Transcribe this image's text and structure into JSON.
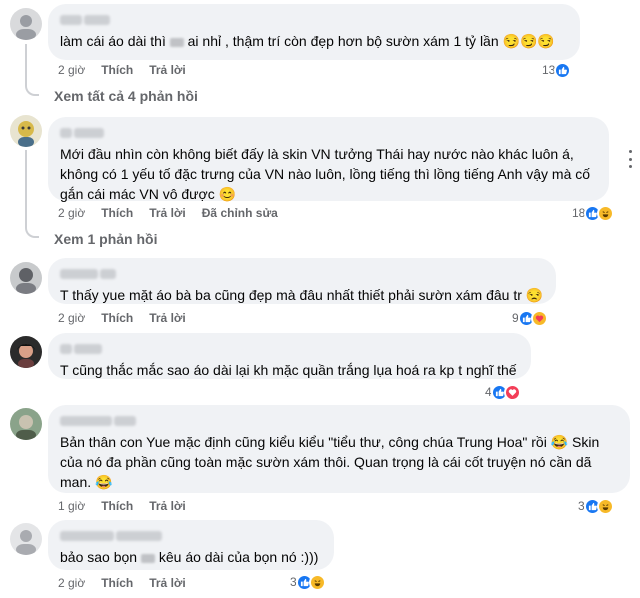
{
  "comments": [
    {
      "text_before": "làm cái áo dài thì ",
      "text_after": " ai nhỉ , thậm trí còn đẹp hơn bộ sườn xám 1 tỷ lần 😏😏😏",
      "time": "2 giờ",
      "like_label": "Thích",
      "reply_label": "Trả lời",
      "reaction_count": "13",
      "reaction_icons": [
        "like-icon"
      ]
    },
    {
      "text": "Mới đầu nhìn còn không biết đấy là skin VN tưởng Thái hay nước nào khác luôn á, không có 1 yếu tố đặc trưng của VN nào luôn, lồng tiếng thì lồng tiếng Anh vậy mà cố gắn cái mác VN vô được 😊",
      "time": "2 giờ",
      "like_label": "Thích",
      "reply_label": "Trả lời",
      "edited_label": "Đã chỉnh sửa",
      "reaction_count": "18",
      "reaction_icons": [
        "like-icon",
        "haha-icon"
      ]
    },
    {
      "text": "T thấy yue mặt áo bà ba cũng đẹp mà đâu nhất thiết phải sườn xám đâu tr 😒",
      "time": "2 giờ",
      "like_label": "Thích",
      "reply_label": "Trả lời",
      "reaction_count": "9",
      "reaction_icons": [
        "like-icon",
        "care-icon"
      ]
    },
    {
      "text": "T cũng thắc mắc sao áo dài lại kh mặc quần trắng lụa hoá ra kp t nghĩ thế",
      "reaction_count": "4",
      "reaction_icons": [
        "like-icon",
        "love-icon"
      ]
    },
    {
      "text": "Bản thân con Yue mặc định cũng kiểu kiểu \"tiểu thư, công chúa Trung Hoa\" rồi 😂 Skin của nó đa phần cũng toàn mặc sườn xám thôi. Quan trọng là cái cốt truyện nó cần dã man. 😂",
      "time": "1 giờ",
      "like_label": "Thích",
      "reply_label": "Trả lời",
      "reaction_count": "3",
      "reaction_icons": [
        "like-icon",
        "haha-icon"
      ]
    },
    {
      "text_before": "bảo sao bọn ",
      "text_after": " kêu áo dài của bọn nó :)))",
      "time": "2 giờ",
      "like_label": "Thích",
      "reply_label": "Trả lời",
      "reaction_count": "3",
      "reaction_icons": [
        "like-icon",
        "haha-icon"
      ]
    }
  ],
  "view_replies": [
    {
      "label": "Xem tất cả 4 phản hồi"
    },
    {
      "label": "Xem 1 phản hồi"
    }
  ],
  "colors": {
    "bubble": "#f0f2f5",
    "like": "#1877f2",
    "love": "#f33e58",
    "haha": "#f7b928",
    "meta_text": "#65676b"
  }
}
